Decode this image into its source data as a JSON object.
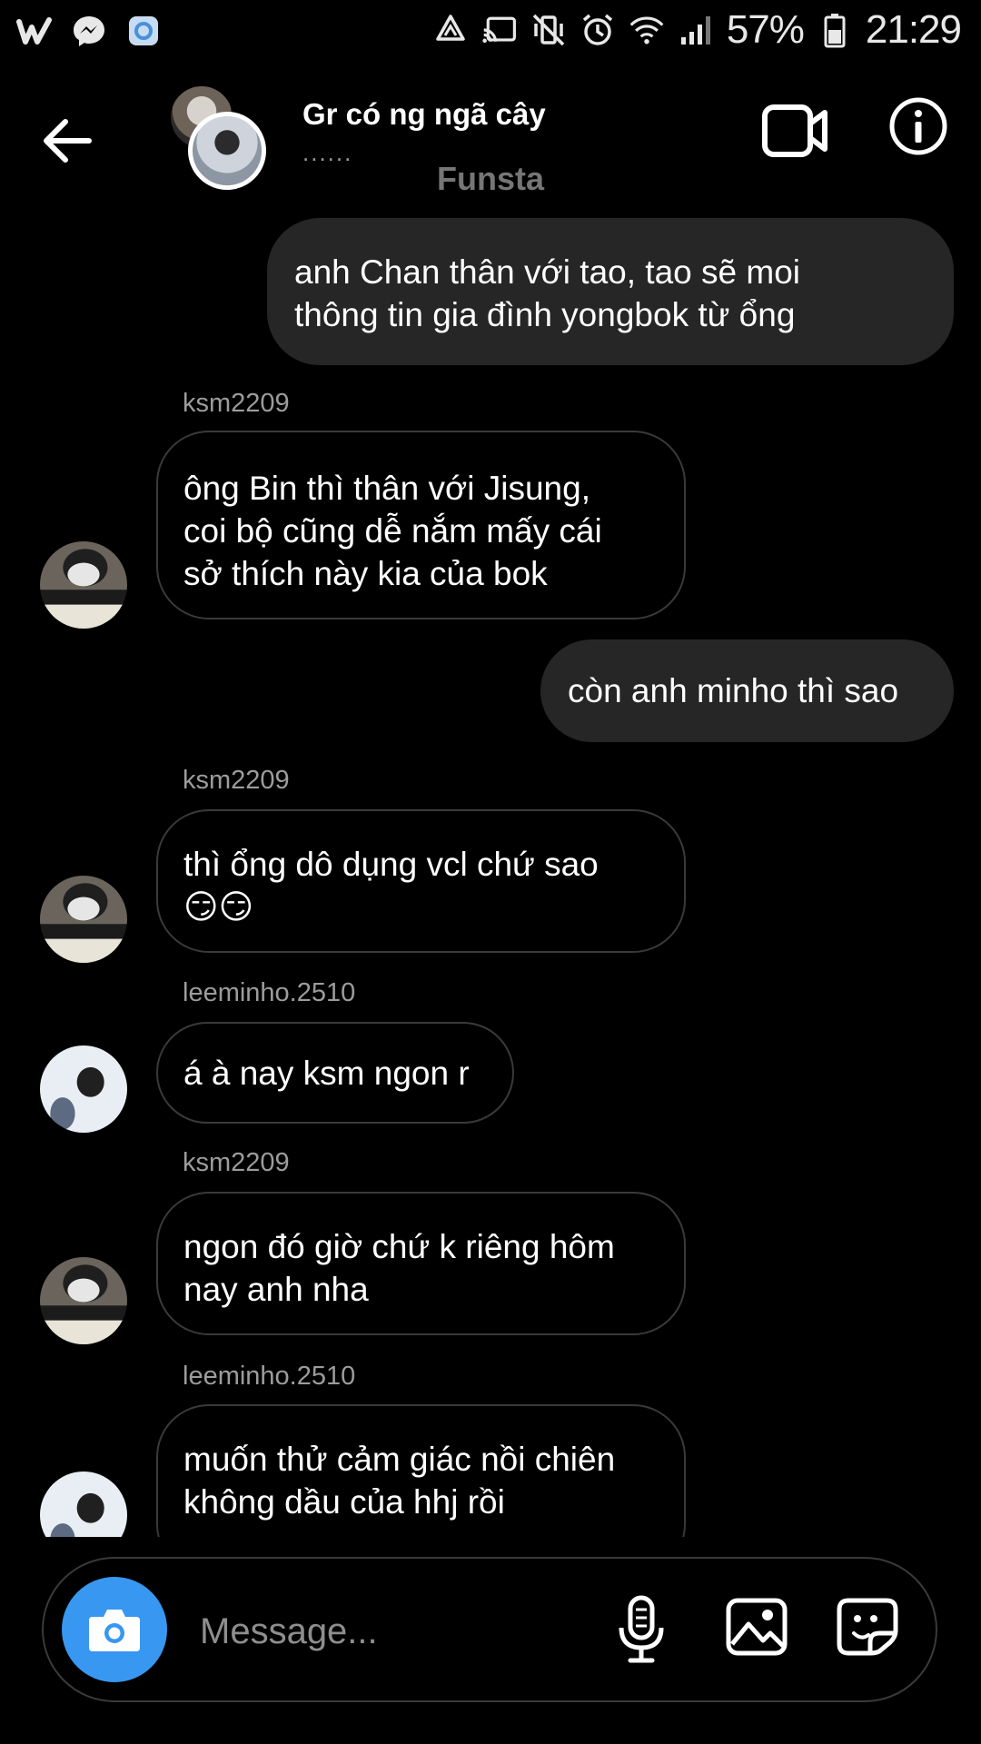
{
  "status_bar": {
    "left_icons": [
      "wattpad-icon",
      "messenger-icon",
      "app-icon"
    ],
    "right_icons": [
      "recycle-icon",
      "cast-icon",
      "vibrate-icon",
      "alarm-icon",
      "wifi-icon",
      "signal-icon",
      "battery-icon"
    ],
    "battery": "57%",
    "time": "21:29"
  },
  "header": {
    "title": "Gr có ng ngã cây",
    "subtitle": "......",
    "label": "Funsta"
  },
  "messages": [
    {
      "type": "outgoing",
      "text_lines": [
        "anh Chan thân với tao, tao sẽ moi",
        "thông tin gia đình yongbok từ ổng"
      ]
    },
    {
      "type": "incoming",
      "sender": "ksm2209",
      "text_lines": [
        "ông Bin thì thân với Jisung,",
        "coi bộ cũng dễ nắm mấy cái",
        "sở thích này kia của bok"
      ]
    },
    {
      "type": "outgoing",
      "text_lines": [
        "còn anh minho thì sao"
      ]
    },
    {
      "type": "incoming",
      "sender": "ksm2209",
      "text_lines": [
        "thì ổng dô dụng vcl chứ sao",
        "😏😏"
      ]
    },
    {
      "type": "incoming",
      "sender": "leeminho.2510",
      "text_lines": [
        "á à nay ksm ngon r"
      ]
    },
    {
      "type": "incoming",
      "sender": "ksm2209",
      "text_lines": [
        "ngon đó giờ chứ k riêng hôm",
        "nay anh nha"
      ]
    },
    {
      "type": "incoming",
      "sender": "leeminho.2510",
      "text_lines": [
        "muốn thử cảm giác nồi chiên",
        "không dầu của hhj rồi"
      ]
    }
  ],
  "composer": {
    "placeholder": "Message...",
    "icons": [
      "camera-icon",
      "microphone-icon",
      "gallery-icon",
      "sticker-icon"
    ],
    "camera_color": "#3897f0"
  }
}
